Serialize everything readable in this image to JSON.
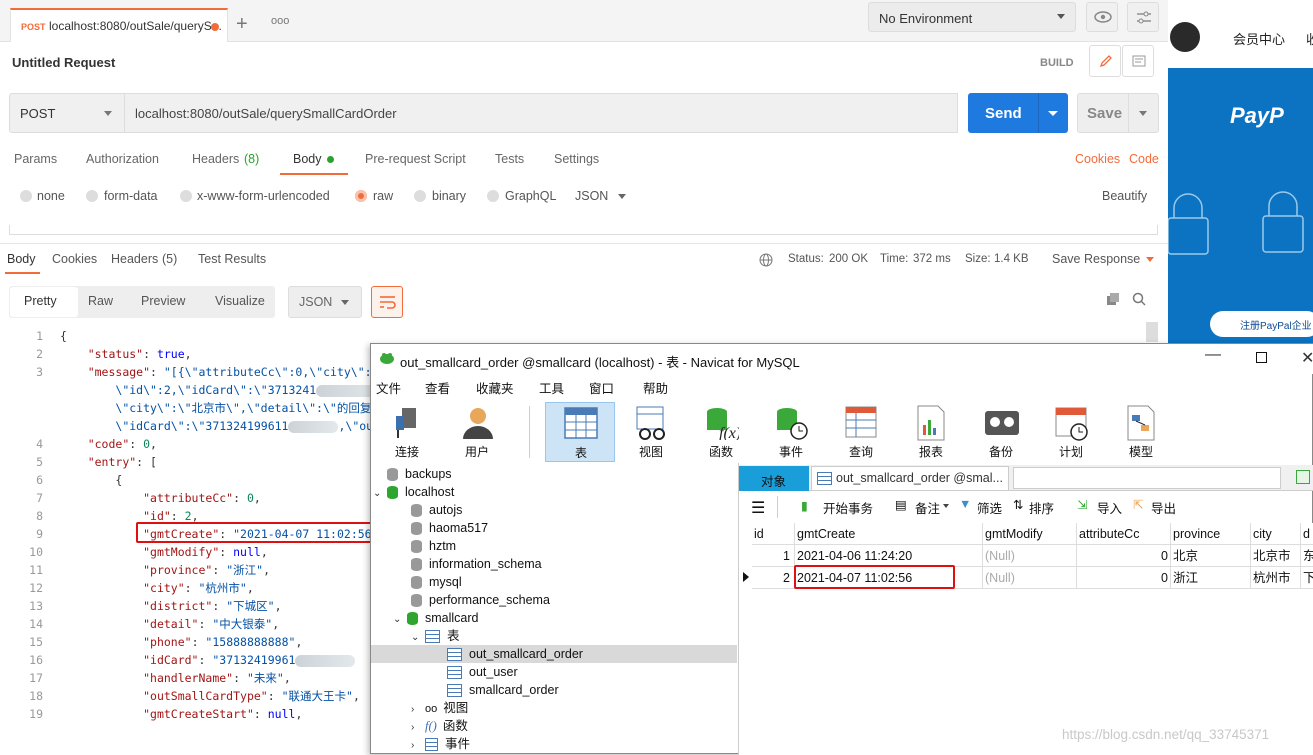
{
  "postman": {
    "request_tab": {
      "method": "POST",
      "url_short": "localhost:8080/outSale/queryS..."
    },
    "environment": "No Environment",
    "request_title": "Untitled Request",
    "build_label": "BUILD",
    "method": "POST",
    "url": "localhost:8080/outSale/querySmallCardOrder",
    "send_label": "Send",
    "save_label": "Save",
    "request_tabs": [
      "Params",
      "Authorization",
      "Headers",
      "(8)",
      "Body",
      "Pre-request Script",
      "Tests",
      "Settings"
    ],
    "cookies_link": "Cookies",
    "code_link": "Code",
    "body_types": [
      "none",
      "form-data",
      "x-www-form-urlencoded",
      "raw",
      "binary",
      "GraphQL"
    ],
    "body_format": "JSON",
    "beautify_link": "Beautify",
    "response_tabs": [
      "Body",
      "Cookies",
      "Headers",
      "(5)",
      "Test Results"
    ],
    "status_label": "Status:",
    "status_value": "200 OK",
    "time_label": "Time:",
    "time_value": "372 ms",
    "size_label": "Size:",
    "size_value": "1.4 KB",
    "save_response": "Save Response",
    "view_modes": [
      "Pretty",
      "Raw",
      "Preview",
      "Visualize"
    ],
    "view_format": "JSON",
    "line_numbers": [
      "1",
      "2",
      "3",
      "4",
      "5",
      "6",
      "7",
      "8",
      "9",
      "10",
      "11",
      "12",
      "13",
      "14",
      "15",
      "16",
      "17",
      "18",
      "19"
    ],
    "json_lines": {
      "l1": "{",
      "status_key": "\"status\"",
      "status_val": "true",
      "message_key": "\"message\"",
      "message_v1": "\"[{\\\"attributeCc\\\":0,\\\"city\\\":\\\"",
      "message_v2": "\\\"id\\\":2,\\\"idCard\\\":\\\"3713241",
      "message_v3": "\\\"city\\\":\\\"北京市\\\",\\\"detail\\\":\\\"的回复\\",
      "message_v4": "\\\"idCard\\\":\\\"371324199611",
      "message_v4b": ",\\\"out",
      "code_key": "\"code\"",
      "code_val": "0",
      "entry_key": "\"entry\"",
      "entry_open": "[",
      "obj_open": "{",
      "attributeCc_key": "\"attributeCc\"",
      "attributeCc_val": "0",
      "id_key": "\"id\"",
      "id_val": "2",
      "gmtCreate_key": "\"gmtCreate\"",
      "gmtCreate_val": "\"2021-04-07 11:02:56\"",
      "gmtModify_key": "\"gmtModify\"",
      "gmtModify_val": "null",
      "province_key": "\"province\"",
      "province_val": "\"浙江\"",
      "city_key": "\"city\"",
      "city_val": "\"杭州市\"",
      "district_key": "\"district\"",
      "district_val": "\"下城区\"",
      "detail_key": "\"detail\"",
      "detail_val": "\"中大银泰\"",
      "phone_key": "\"phone\"",
      "phone_val": "\"15888888888\"",
      "idCard_key": "\"idCard\"",
      "idCard_val": "\"37132419961",
      "handlerName_key": "\"handlerName\"",
      "handlerName_val": "\"未来\"",
      "outSmallCardType_key": "\"outSmallCardType\"",
      "outSmallCardType_val": "\"联通大王卡\"",
      "gmtCreateStart_key": "\"gmtCreateStart\"",
      "gmtCreateStart_val": "null"
    }
  },
  "side_page": {
    "member_center": "会员中心",
    "cut_text": "收",
    "paypal_logo": "PayP",
    "paypal_button": "注册PayPal企业"
  },
  "navicat": {
    "title": "out_smallcard_order @smallcard (localhost) - 表 - Navicat for MySQL",
    "menu": [
      "文件",
      "查看",
      "收藏夹",
      "工具",
      "窗口",
      "帮助"
    ],
    "toolbar": [
      "连接",
      "用户",
      "表",
      "视图",
      "函数",
      "事件",
      "查询",
      "报表",
      "备份",
      "计划",
      "模型"
    ],
    "tree": {
      "backups": "backups",
      "localhost": "localhost",
      "dbs": [
        "autojs",
        "haoma517",
        "hztm",
        "information_schema",
        "mysql",
        "performance_schema"
      ],
      "smallcard": "smallcard",
      "tables_folder": "表",
      "tables": [
        "out_smallcard_order",
        "out_user",
        "smallcard_order"
      ],
      "views": "视图",
      "functions": "函数",
      "events": "事件"
    },
    "object_tab": "对象",
    "table_tab": "out_smallcard_order @smal...",
    "grid_toolbar": [
      "开始事务",
      "备注",
      "筛选",
      "排序",
      "导入",
      "导出"
    ],
    "columns": [
      "id",
      "gmtCreate",
      "gmtModify",
      "attributeCc",
      "province",
      "city",
      "d"
    ],
    "rows": [
      {
        "id": "1",
        "gmtCreate": "2021-04-06 11:24:20",
        "gmtModify": "(Null)",
        "attributeCc": "0",
        "province": "北京",
        "city": "北京市",
        "d": "东"
      },
      {
        "id": "2",
        "gmtCreate": "2021-04-07 11:02:56",
        "gmtModify": "(Null)",
        "attributeCc": "0",
        "province": "浙江",
        "city": "杭州市",
        "d": "下"
      }
    ]
  },
  "watermark": "https://blog.csdn.net/qq_33745371",
  "colors": {
    "postman_orange": "#f26b3a",
    "send_blue": "#1f7ae0",
    "status_green": "#2aa32a",
    "highlight_red": "#e01010",
    "paypal_blue": "#0b73c2"
  }
}
